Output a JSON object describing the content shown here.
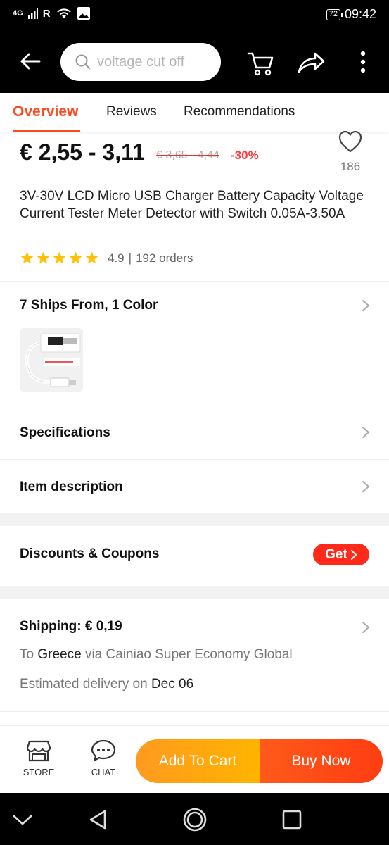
{
  "status_bar": {
    "network": "4G",
    "carrier_flag": "R",
    "battery": "72",
    "time": "09:42"
  },
  "search": {
    "placeholder": "voltage cut off"
  },
  "tabs": [
    {
      "label": "Overview",
      "active": true
    },
    {
      "label": "Reviews",
      "active": false
    },
    {
      "label": "Recommendations",
      "active": false
    }
  ],
  "product": {
    "price": "€ 2,55 - 3,11",
    "old_price": "€ 3,65 - 4,44",
    "discount": "-30%",
    "wishlist_count": "186",
    "title": "3V-30V LCD Micro USB Charger Battery Capacity Voltage Current Tester Meter Detector with Switch 0.05A-3.50A",
    "rating": "4.9",
    "rating_separator": "|",
    "orders": "192 orders",
    "star_count": 5
  },
  "sections": {
    "ships_from": "7 Ships From, 1 Color",
    "specifications": "Specifications",
    "item_description": "Item description",
    "discounts": "Discounts & Coupons",
    "get_label": "Get"
  },
  "shipping": {
    "title": "Shipping: € 0,19",
    "to_prefix": "To",
    "country": "Greece",
    "via": "via Cainiao Super Economy Global",
    "estimated_prefix": "Estimated delivery on",
    "delivery_date": "Dec 06"
  },
  "bottom_bar": {
    "store_label": "STORE",
    "chat_label": "CHAT",
    "add_to_cart": "Add To Cart",
    "buy_now": "Buy Now"
  },
  "colors": {
    "accent": "#ff4a1f",
    "discount": "#ff3b3b",
    "star": "#ffc107",
    "cart_gradient": "#ff9a1f",
    "buy_gradient": "#ff3d12"
  },
  "icons": [
    "back-arrow-icon",
    "search-icon",
    "cart-icon",
    "share-icon",
    "more-icon",
    "heart-icon",
    "star-icon",
    "chevron-right-icon",
    "store-icon",
    "chat-icon"
  ]
}
